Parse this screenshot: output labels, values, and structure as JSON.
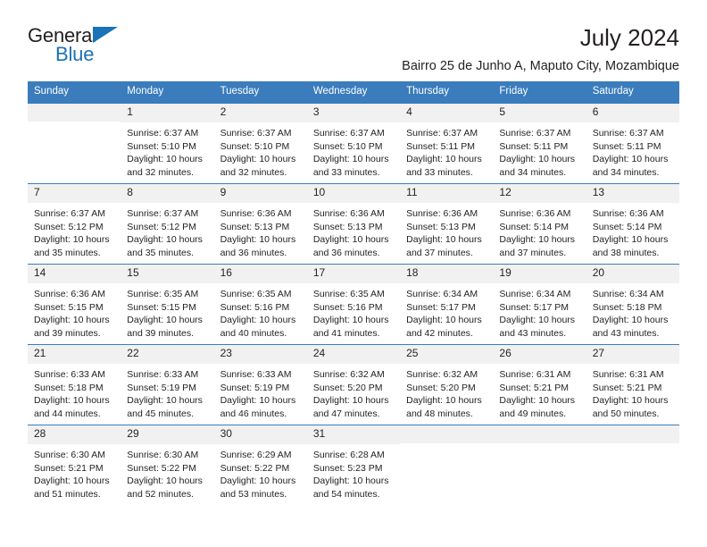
{
  "brand": {
    "name_part1": "General",
    "name_part2": "Blue",
    "accent_color": "#1b72b8"
  },
  "header": {
    "title": "July 2024",
    "subtitle": "Bairro 25 de Junho A, Maputo City, Mozambique"
  },
  "theme": {
    "header_bg": "#3a7cbc",
    "daynum_bg": "#f1f1f1",
    "text": "#231f20"
  },
  "calendar": {
    "weekdays": [
      "Sunday",
      "Monday",
      "Tuesday",
      "Wednesday",
      "Thursday",
      "Friday",
      "Saturday"
    ],
    "weeks": [
      [
        {
          "day": "",
          "empty": true,
          "sunrise": "",
          "sunset": "",
          "daylight1": "",
          "daylight2": ""
        },
        {
          "day": "1",
          "sunrise": "Sunrise: 6:37 AM",
          "sunset": "Sunset: 5:10 PM",
          "daylight1": "Daylight: 10 hours",
          "daylight2": "and 32 minutes."
        },
        {
          "day": "2",
          "sunrise": "Sunrise: 6:37 AM",
          "sunset": "Sunset: 5:10 PM",
          "daylight1": "Daylight: 10 hours",
          "daylight2": "and 32 minutes."
        },
        {
          "day": "3",
          "sunrise": "Sunrise: 6:37 AM",
          "sunset": "Sunset: 5:10 PM",
          "daylight1": "Daylight: 10 hours",
          "daylight2": "and 33 minutes."
        },
        {
          "day": "4",
          "sunrise": "Sunrise: 6:37 AM",
          "sunset": "Sunset: 5:11 PM",
          "daylight1": "Daylight: 10 hours",
          "daylight2": "and 33 minutes."
        },
        {
          "day": "5",
          "sunrise": "Sunrise: 6:37 AM",
          "sunset": "Sunset: 5:11 PM",
          "daylight1": "Daylight: 10 hours",
          "daylight2": "and 34 minutes."
        },
        {
          "day": "6",
          "sunrise": "Sunrise: 6:37 AM",
          "sunset": "Sunset: 5:11 PM",
          "daylight1": "Daylight: 10 hours",
          "daylight2": "and 34 minutes."
        }
      ],
      [
        {
          "day": "7",
          "sunrise": "Sunrise: 6:37 AM",
          "sunset": "Sunset: 5:12 PM",
          "daylight1": "Daylight: 10 hours",
          "daylight2": "and 35 minutes."
        },
        {
          "day": "8",
          "sunrise": "Sunrise: 6:37 AM",
          "sunset": "Sunset: 5:12 PM",
          "daylight1": "Daylight: 10 hours",
          "daylight2": "and 35 minutes."
        },
        {
          "day": "9",
          "sunrise": "Sunrise: 6:36 AM",
          "sunset": "Sunset: 5:13 PM",
          "daylight1": "Daylight: 10 hours",
          "daylight2": "and 36 minutes."
        },
        {
          "day": "10",
          "sunrise": "Sunrise: 6:36 AM",
          "sunset": "Sunset: 5:13 PM",
          "daylight1": "Daylight: 10 hours",
          "daylight2": "and 36 minutes."
        },
        {
          "day": "11",
          "sunrise": "Sunrise: 6:36 AM",
          "sunset": "Sunset: 5:13 PM",
          "daylight1": "Daylight: 10 hours",
          "daylight2": "and 37 minutes."
        },
        {
          "day": "12",
          "sunrise": "Sunrise: 6:36 AM",
          "sunset": "Sunset: 5:14 PM",
          "daylight1": "Daylight: 10 hours",
          "daylight2": "and 37 minutes."
        },
        {
          "day": "13",
          "sunrise": "Sunrise: 6:36 AM",
          "sunset": "Sunset: 5:14 PM",
          "daylight1": "Daylight: 10 hours",
          "daylight2": "and 38 minutes."
        }
      ],
      [
        {
          "day": "14",
          "sunrise": "Sunrise: 6:36 AM",
          "sunset": "Sunset: 5:15 PM",
          "daylight1": "Daylight: 10 hours",
          "daylight2": "and 39 minutes."
        },
        {
          "day": "15",
          "sunrise": "Sunrise: 6:35 AM",
          "sunset": "Sunset: 5:15 PM",
          "daylight1": "Daylight: 10 hours",
          "daylight2": "and 39 minutes."
        },
        {
          "day": "16",
          "sunrise": "Sunrise: 6:35 AM",
          "sunset": "Sunset: 5:16 PM",
          "daylight1": "Daylight: 10 hours",
          "daylight2": "and 40 minutes."
        },
        {
          "day": "17",
          "sunrise": "Sunrise: 6:35 AM",
          "sunset": "Sunset: 5:16 PM",
          "daylight1": "Daylight: 10 hours",
          "daylight2": "and 41 minutes."
        },
        {
          "day": "18",
          "sunrise": "Sunrise: 6:34 AM",
          "sunset": "Sunset: 5:17 PM",
          "daylight1": "Daylight: 10 hours",
          "daylight2": "and 42 minutes."
        },
        {
          "day": "19",
          "sunrise": "Sunrise: 6:34 AM",
          "sunset": "Sunset: 5:17 PM",
          "daylight1": "Daylight: 10 hours",
          "daylight2": "and 43 minutes."
        },
        {
          "day": "20",
          "sunrise": "Sunrise: 6:34 AM",
          "sunset": "Sunset: 5:18 PM",
          "daylight1": "Daylight: 10 hours",
          "daylight2": "and 43 minutes."
        }
      ],
      [
        {
          "day": "21",
          "sunrise": "Sunrise: 6:33 AM",
          "sunset": "Sunset: 5:18 PM",
          "daylight1": "Daylight: 10 hours",
          "daylight2": "and 44 minutes."
        },
        {
          "day": "22",
          "sunrise": "Sunrise: 6:33 AM",
          "sunset": "Sunset: 5:19 PM",
          "daylight1": "Daylight: 10 hours",
          "daylight2": "and 45 minutes."
        },
        {
          "day": "23",
          "sunrise": "Sunrise: 6:33 AM",
          "sunset": "Sunset: 5:19 PM",
          "daylight1": "Daylight: 10 hours",
          "daylight2": "and 46 minutes."
        },
        {
          "day": "24",
          "sunrise": "Sunrise: 6:32 AM",
          "sunset": "Sunset: 5:20 PM",
          "daylight1": "Daylight: 10 hours",
          "daylight2": "and 47 minutes."
        },
        {
          "day": "25",
          "sunrise": "Sunrise: 6:32 AM",
          "sunset": "Sunset: 5:20 PM",
          "daylight1": "Daylight: 10 hours",
          "daylight2": "and 48 minutes."
        },
        {
          "day": "26",
          "sunrise": "Sunrise: 6:31 AM",
          "sunset": "Sunset: 5:21 PM",
          "daylight1": "Daylight: 10 hours",
          "daylight2": "and 49 minutes."
        },
        {
          "day": "27",
          "sunrise": "Sunrise: 6:31 AM",
          "sunset": "Sunset: 5:21 PM",
          "daylight1": "Daylight: 10 hours",
          "daylight2": "and 50 minutes."
        }
      ],
      [
        {
          "day": "28",
          "sunrise": "Sunrise: 6:30 AM",
          "sunset": "Sunset: 5:21 PM",
          "daylight1": "Daylight: 10 hours",
          "daylight2": "and 51 minutes."
        },
        {
          "day": "29",
          "sunrise": "Sunrise: 6:30 AM",
          "sunset": "Sunset: 5:22 PM",
          "daylight1": "Daylight: 10 hours",
          "daylight2": "and 52 minutes."
        },
        {
          "day": "30",
          "sunrise": "Sunrise: 6:29 AM",
          "sunset": "Sunset: 5:22 PM",
          "daylight1": "Daylight: 10 hours",
          "daylight2": "and 53 minutes."
        },
        {
          "day": "31",
          "sunrise": "Sunrise: 6:28 AM",
          "sunset": "Sunset: 5:23 PM",
          "daylight1": "Daylight: 10 hours",
          "daylight2": "and 54 minutes."
        },
        {
          "day": "",
          "empty": true,
          "sunrise": "",
          "sunset": "",
          "daylight1": "",
          "daylight2": ""
        },
        {
          "day": "",
          "empty": true,
          "sunrise": "",
          "sunset": "",
          "daylight1": "",
          "daylight2": ""
        },
        {
          "day": "",
          "empty": true,
          "sunrise": "",
          "sunset": "",
          "daylight1": "",
          "daylight2": ""
        }
      ]
    ]
  }
}
